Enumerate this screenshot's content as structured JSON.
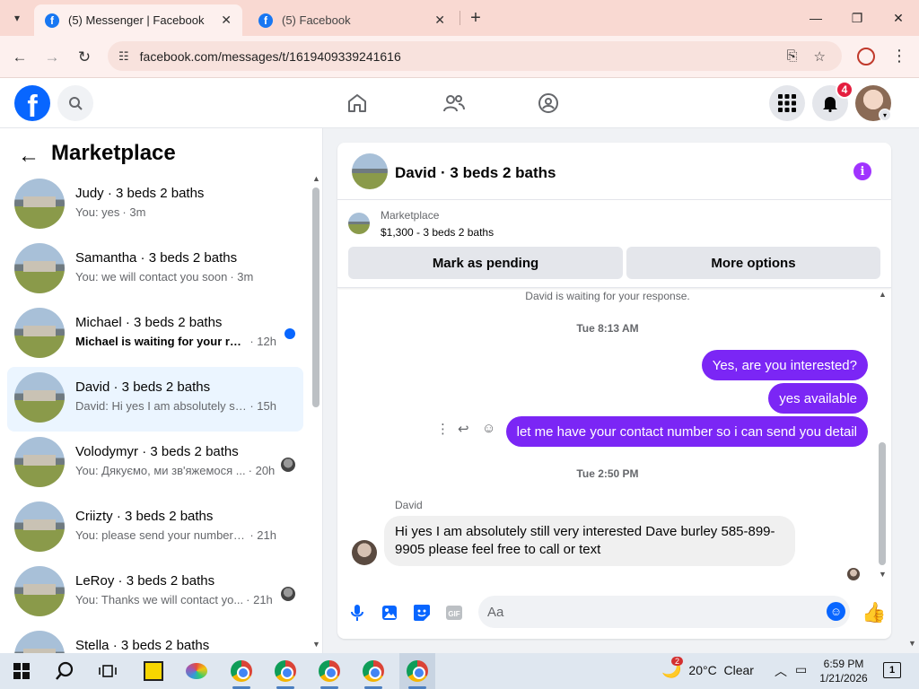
{
  "browser": {
    "tabs": [
      {
        "label": "(5) Messenger | Facebook",
        "active": true
      },
      {
        "label": "(5) Facebook",
        "active": false
      }
    ],
    "url": "facebook.com/messages/t/1619409339241616"
  },
  "fb_header": {
    "logo": "f",
    "notification_count": "4"
  },
  "sidebar": {
    "title": "Marketplace",
    "conversations": [
      {
        "name": "Judy · 3 beds 2 baths",
        "preview": "You: yes",
        "time": "· 3m",
        "unread": false,
        "selected": false
      },
      {
        "name": "Samantha · 3 beds 2 baths",
        "preview": "You: we will contact you soon",
        "time": "· 3m",
        "unread": false,
        "selected": false
      },
      {
        "name": "Michael · 3 beds 2 baths",
        "preview": "Michael is waiting for your res...",
        "time": "· 12h",
        "unread": true,
        "selected": false
      },
      {
        "name": "David · 3 beds 2 baths",
        "preview": "David: Hi yes I am absolutely still v...",
        "time": "· 15h",
        "unread": false,
        "selected": true
      },
      {
        "name": "Volodymyr · 3 beds 2 baths",
        "preview": "You: Дякуємо, ми зв'яжемося ...",
        "time": "· 20h",
        "unread": false,
        "selected": false
      },
      {
        "name": "Criizty · 3 beds 2 baths",
        "preview": "You: please send your number for ...",
        "time": "· 21h",
        "unread": false,
        "selected": false
      },
      {
        "name": "LeRoy · 3 beds 2 baths",
        "preview": "You: Thanks we will contact yo...",
        "time": "· 21h",
        "unread": false,
        "selected": false
      },
      {
        "name": "Stella · 3 beds 2 baths",
        "preview": "",
        "time": "",
        "unread": false,
        "selected": false
      }
    ]
  },
  "chat": {
    "title": "David · 3 beds 2 baths",
    "listing": {
      "source": "Marketplace",
      "price_title": "$1,300 - 3 beds 2 baths",
      "mark_pending": "Mark as pending",
      "more_options": "More options"
    },
    "waiting_notice": "David is waiting for your response.",
    "timestamp1": "Tue 8:13 AM",
    "outgoing": [
      "Yes, are you interested?",
      "yes available",
      "let me have your contact number so i can send you detail"
    ],
    "timestamp2": "Tue 2:50 PM",
    "incoming_sender": "David",
    "incoming_text": "Hi yes I am absolutely still very interested Dave burley 585-899-9905 please feel free to call or text",
    "composer_placeholder": "Aa"
  },
  "taskbar": {
    "weather_badge": "2",
    "weather_text": "20°C  Clear",
    "time": "6:59 PM",
    "date": "1/21/2026",
    "notifications": "1"
  },
  "colors": {
    "brand_blue": "#0866ff",
    "outgoing_bubble": "#7b26f5",
    "selected_conv": "#ebf5ff"
  }
}
